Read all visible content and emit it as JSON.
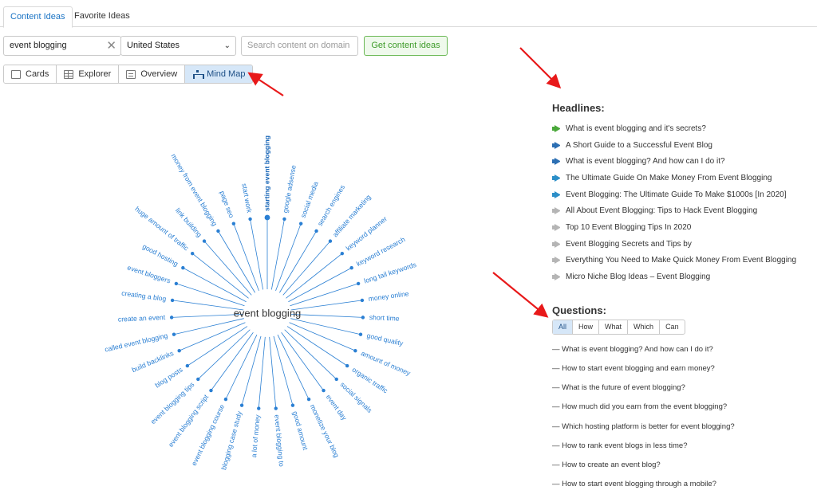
{
  "tabs": [
    {
      "label": "Content Ideas"
    },
    {
      "label": "Favorite Ideas"
    }
  ],
  "search": {
    "keyword": "event blogging",
    "clear_icon": "close-icon",
    "country": "United States",
    "domain_placeholder": "Search content on domain",
    "submit_label": "Get content ideas"
  },
  "views": [
    {
      "label": "Cards",
      "icon": "cards-icon"
    },
    {
      "label": "Explorer",
      "icon": "table-icon"
    },
    {
      "label": "Overview",
      "icon": "overview-icon"
    },
    {
      "label": "Mind Map",
      "icon": "mind-map-icon",
      "active": true
    }
  ],
  "mindmap": {
    "center": "event blogging",
    "topics": [
      "starting event blogging",
      "google adsense",
      "social media",
      "search engines",
      "affiliate marketing",
      "keyword planner",
      "keyword research",
      "long tail keywords",
      "money online",
      "short time",
      "good quality",
      "amount of money",
      "organic traffic",
      "social signals",
      "event day",
      "monetize your blog",
      "good amount",
      "event blogging to",
      "a lot of money",
      "blogging case study",
      "event blogging course",
      "event blogging script",
      "event blogging tips",
      "blog posts",
      "build backlinks",
      "called event blogging",
      "create an event",
      "creating a blog",
      "event bloggers",
      "good hosting",
      "huge amount of traffic",
      "link building",
      "money from event blogging",
      "page seo",
      "start work"
    ]
  },
  "headlines": {
    "title": "Headlines:",
    "items": [
      {
        "text": "What is event blogging and it's secrets?",
        "color": "#4aa83a"
      },
      {
        "text": "A Short Guide to a Successful Event Blog",
        "color": "#2c6fb3"
      },
      {
        "text": "What is event blogging? And how can I do it?",
        "color": "#2c6fb3"
      },
      {
        "text": "The Ultimate Guide On Make Money From Event Blogging",
        "color": "#2c8fc8"
      },
      {
        "text": "Event Blogging: The Ultimate Guide To Make $1000s [In 2020]",
        "color": "#2c8fc8"
      },
      {
        "text": "All About Event Blogging: Tips to Hack Event Blogging",
        "color": "#b5b5b5"
      },
      {
        "text": "Top 10 Event Blogging Tips In 2020",
        "color": "#b5b5b5"
      },
      {
        "text": "Event Blogging Secrets and Tips by",
        "color": "#b5b5b5"
      },
      {
        "text": "Everything You Need to Make Quick Money From Event Blogging",
        "color": "#b5b5b5"
      },
      {
        "text": "Micro Niche Blog Ideas – Event Blogging",
        "color": "#b5b5b5"
      }
    ]
  },
  "questions": {
    "title": "Questions:",
    "filters": [
      {
        "label": "All",
        "active": true
      },
      {
        "label": "How"
      },
      {
        "label": "What"
      },
      {
        "label": "Which"
      },
      {
        "label": "Can"
      }
    ],
    "items": [
      "— What is event blogging? And how can I do it?",
      "— How to start event blogging and earn money?",
      "— What is the future of event blogging?",
      "— How much did you earn from the event blogging?",
      "— Which hosting platform is better for event blogging?",
      "— How to rank event blogs in less time?",
      "— How to create an event blog?",
      "— How to start event blogging through a mobile?"
    ]
  },
  "colors": {
    "accent": "#1a73c4",
    "spoke": "#2a7fd3",
    "annotation_arrow": "#e8191a",
    "green_button": "#3e9b2a"
  }
}
